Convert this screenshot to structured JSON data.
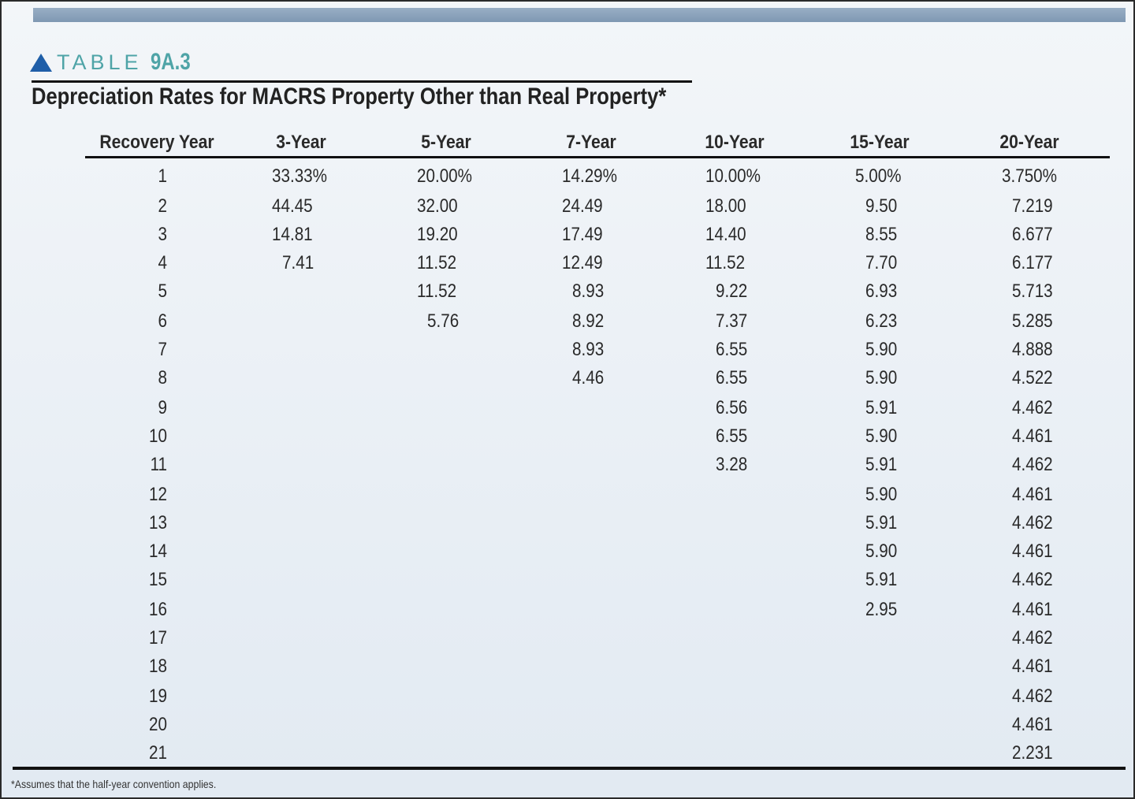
{
  "table_label": {
    "word": "TABLE",
    "number": "9A.3"
  },
  "title": "Depreciation Rates for MACRS Property Other than Real Property*",
  "columns": [
    "Recovery Year",
    "3-Year",
    "5-Year",
    "7-Year",
    "10-Year",
    "15-Year",
    "20-Year"
  ],
  "rows": [
    [
      "1",
      "33.33%",
      "20.00%",
      "14.29%",
      "10.00%",
      "5.00%",
      "3.750%"
    ],
    [
      "2",
      "44.45",
      "32.00",
      "24.49",
      "18.00",
      "9.50",
      "7.219"
    ],
    [
      "3",
      "14.81",
      "19.20",
      "17.49",
      "14.40",
      "8.55",
      "6.677"
    ],
    [
      "4",
      "7.41",
      "11.52",
      "12.49",
      "11.52",
      "7.70",
      "6.177"
    ],
    [
      "5",
      "",
      "11.52",
      "8.93",
      "9.22",
      "6.93",
      "5.713"
    ],
    [
      "6",
      "",
      "5.76",
      "8.92",
      "7.37",
      "6.23",
      "5.285"
    ],
    [
      "7",
      "",
      "",
      "8.93",
      "6.55",
      "5.90",
      "4.888"
    ],
    [
      "8",
      "",
      "",
      "4.46",
      "6.55",
      "5.90",
      "4.522"
    ],
    [
      "9",
      "",
      "",
      "",
      "6.56",
      "5.91",
      "4.462"
    ],
    [
      "10",
      "",
      "",
      "",
      "6.55",
      "5.90",
      "4.461"
    ],
    [
      "11",
      "",
      "",
      "",
      "3.28",
      "5.91",
      "4.462"
    ],
    [
      "12",
      "",
      "",
      "",
      "",
      "5.90",
      "4.461"
    ],
    [
      "13",
      "",
      "",
      "",
      "",
      "5.91",
      "4.462"
    ],
    [
      "14",
      "",
      "",
      "",
      "",
      "5.90",
      "4.461"
    ],
    [
      "15",
      "",
      "",
      "",
      "",
      "5.91",
      "4.462"
    ],
    [
      "16",
      "",
      "",
      "",
      "",
      "2.95",
      "4.461"
    ],
    [
      "17",
      "",
      "",
      "",
      "",
      "",
      "4.462"
    ],
    [
      "18",
      "",
      "",
      "",
      "",
      "",
      "4.461"
    ],
    [
      "19",
      "",
      "",
      "",
      "",
      "",
      "4.462"
    ],
    [
      "20",
      "",
      "",
      "",
      "",
      "",
      "4.461"
    ],
    [
      "21",
      "",
      "",
      "",
      "",
      "",
      "2.231"
    ]
  ],
  "footnote": "*Assumes that the half-year convention applies.",
  "colors": {
    "accent_blue": "#1f5ea8",
    "label_teal": "#4fa4a7",
    "top_bar": "#8aa3bd"
  },
  "icons": {
    "label_marker": "triangle-icon"
  }
}
